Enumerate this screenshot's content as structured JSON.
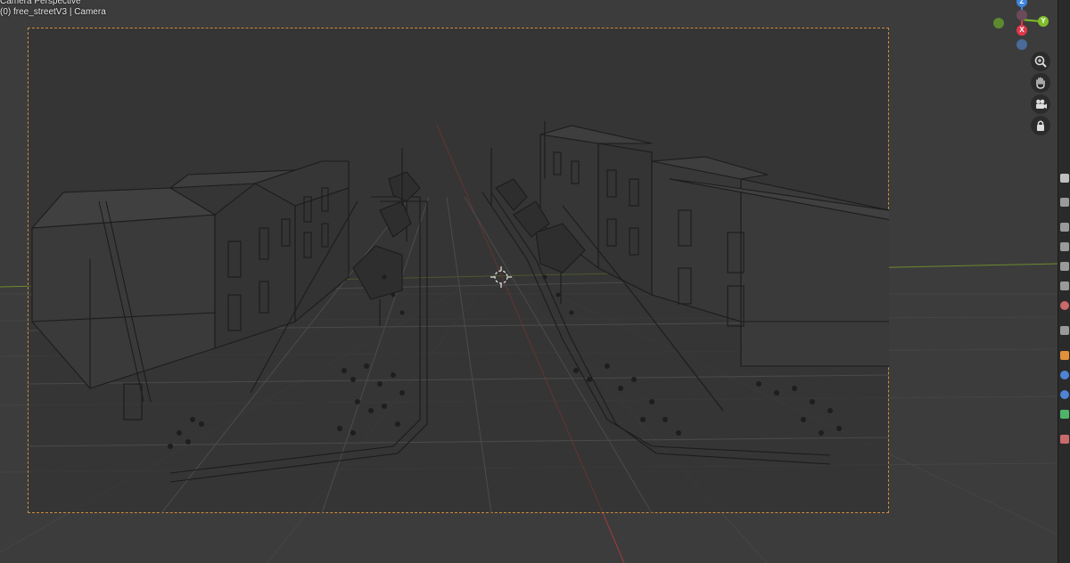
{
  "viewport": {
    "mode_label": "Camera Perspective",
    "scene_label": "(0) free_streetV3 | Camera"
  },
  "gizmo": {
    "z_label": "Z",
    "y_label": "Y",
    "x_label": "X",
    "colors": {
      "x": "#e0384b",
      "y": "#7fbd2a",
      "z": "#3f84de",
      "neg": "#5a6fa0"
    }
  },
  "nav_tools": [
    {
      "name": "zoom-icon",
      "glyph": "🔍"
    },
    {
      "name": "pan-hand-icon",
      "glyph": "✋"
    },
    {
      "name": "camera-view-icon",
      "glyph": "🎥"
    },
    {
      "name": "lock-icon",
      "glyph": "🔒"
    }
  ],
  "frame": {
    "border_color": "#d08a3c"
  },
  "properties_tabs": [
    {
      "name": "tool-tab-icon",
      "color": "#bfbfbf"
    },
    {
      "name": "render-tab-icon",
      "color": "#bfbfbf"
    },
    {
      "name": "output-tab-icon",
      "color": "#bfbfbf"
    },
    {
      "name": "view-layer-tab-icon",
      "color": "#bfbfbf"
    },
    {
      "name": "scene-tab-icon",
      "color": "#bfbfbf"
    },
    {
      "name": "world-tab-icon",
      "color": "#c96b6b"
    },
    {
      "name": "collection-tab-icon",
      "color": "#bfbfbf"
    },
    {
      "name": "object-tab-icon",
      "color": "#e0913a"
    },
    {
      "name": "modifier-tab-icon",
      "color": "#4f84d4"
    },
    {
      "name": "physics-tab-icon",
      "color": "#4f84d4"
    },
    {
      "name": "constraints-tab-icon",
      "color": "#4fb36a"
    },
    {
      "name": "texture-tab-icon",
      "color": "#c96b6b"
    }
  ]
}
